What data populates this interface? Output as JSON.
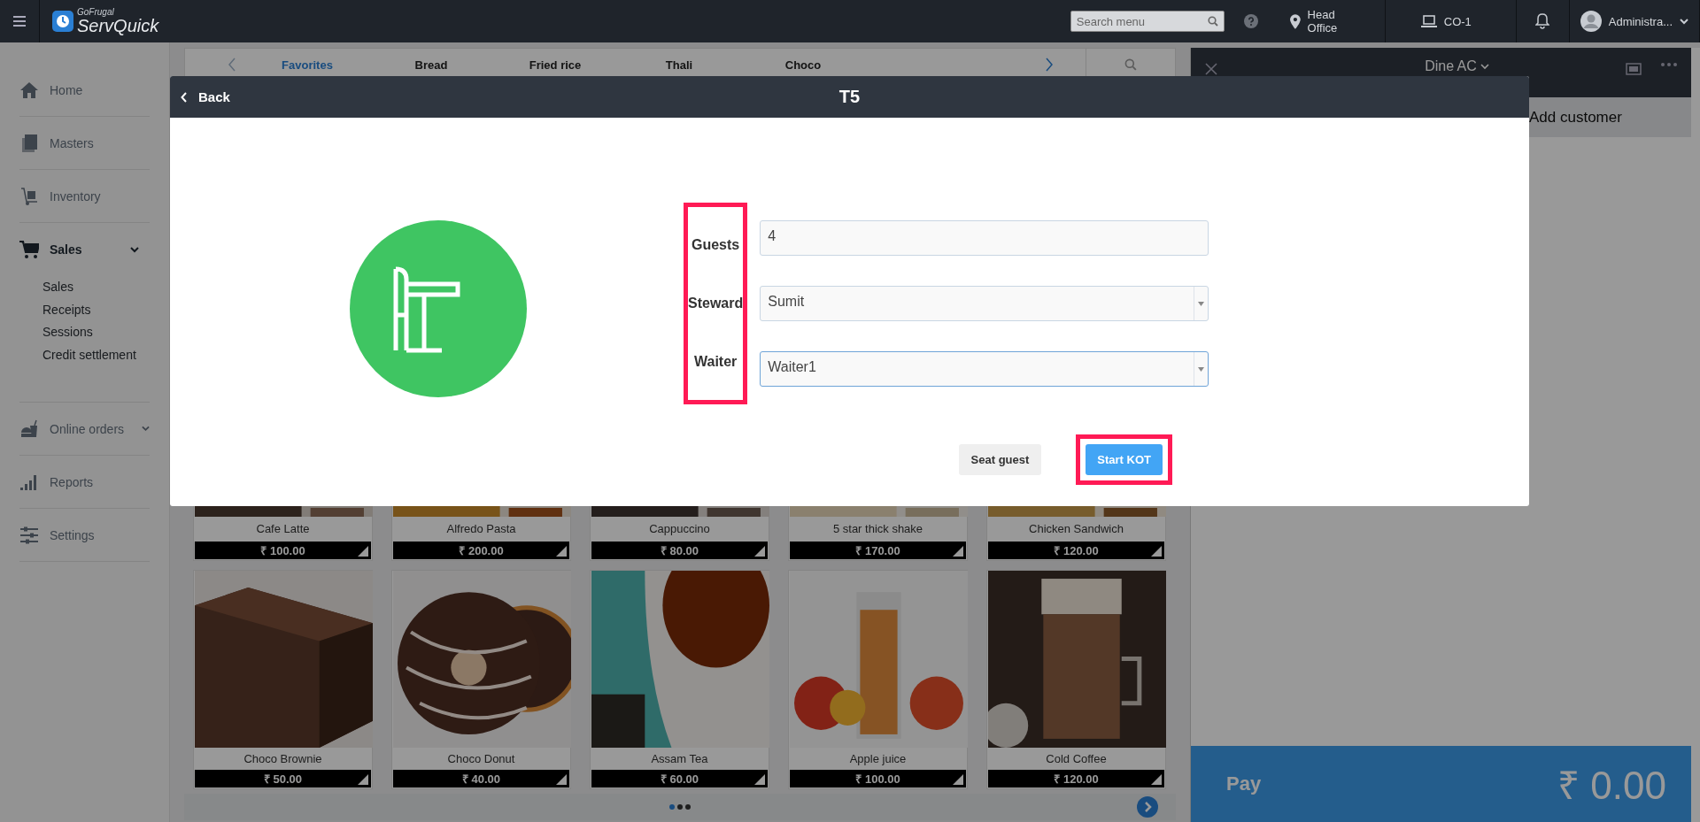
{
  "top_bar": {
    "brand_small": "GoFrugal",
    "brand": "ServQuick",
    "search": {
      "placeholder": "Search menu"
    },
    "location": "Head Office",
    "counter": "CO-1",
    "user": "Administra..."
  },
  "sidebar": {
    "items": [
      {
        "label": "Home",
        "kind": "link",
        "selected": false
      },
      {
        "label": "Masters",
        "kind": "link",
        "selected": false
      },
      {
        "label": "Inventory",
        "kind": "link",
        "selected": false
      },
      {
        "label": "Sales",
        "kind": "group",
        "selected": true,
        "children": [
          "Sales",
          "Receipts",
          "Sessions",
          "Credit settlement"
        ]
      },
      {
        "label": "Online orders",
        "kind": "group",
        "selected": false
      },
      {
        "label": "Reports",
        "kind": "link",
        "selected": false
      },
      {
        "label": "Settings",
        "kind": "link",
        "selected": false
      }
    ]
  },
  "categories": [
    {
      "label": "Favorites",
      "selected": true
    },
    {
      "label": "Bread",
      "selected": false
    },
    {
      "label": "Fried rice",
      "selected": false
    },
    {
      "label": "Thali",
      "selected": false
    },
    {
      "label": "Choco",
      "selected": false
    }
  ],
  "products": [
    [
      {
        "name": "Cafe Latte",
        "price": "₹ 100.00"
      },
      {
        "name": "Alfredo Pasta",
        "price": "₹ 200.00"
      },
      {
        "name": "Cappuccino",
        "price": "₹ 80.00"
      },
      {
        "name": "5 star thick shake",
        "price": "₹ 170.00"
      },
      {
        "name": "Chicken Sandwich",
        "price": "₹ 120.00"
      }
    ],
    [
      {
        "name": "Choco Brownie",
        "price": "₹ 50.00"
      },
      {
        "name": "Choco Donut",
        "price": "₹ 40.00"
      },
      {
        "name": "Assam Tea",
        "price": "₹ 60.00"
      },
      {
        "name": "Apple juice",
        "price": "₹ 100.00"
      },
      {
        "name": "Cold Coffee",
        "price": "₹ 120.00"
      }
    ]
  ],
  "pages": [
    {
      "selected": true
    },
    {
      "selected": false
    },
    {
      "selected": false
    }
  ],
  "order_panel": {
    "title": "Dine AC",
    "customer": "Add customer",
    "pay": {
      "label": "Pay",
      "amount": "₹ 0.00"
    }
  },
  "modal": {
    "back": "Back",
    "title": "T5",
    "labels_highlighted": true,
    "fields": [
      {
        "label": "Guests",
        "kind": "input",
        "value": "4",
        "focused": false
      },
      {
        "label": "Steward",
        "kind": "select",
        "value": "Sumit",
        "focused": false
      },
      {
        "label": "Waiter",
        "kind": "select",
        "value": "Waiter1",
        "focused": true
      }
    ],
    "buttons": [
      {
        "label": "Seat guest",
        "primary": false,
        "highlighted": false
      },
      {
        "label": "Start KOT",
        "primary": true,
        "highlighted": true
      }
    ]
  }
}
